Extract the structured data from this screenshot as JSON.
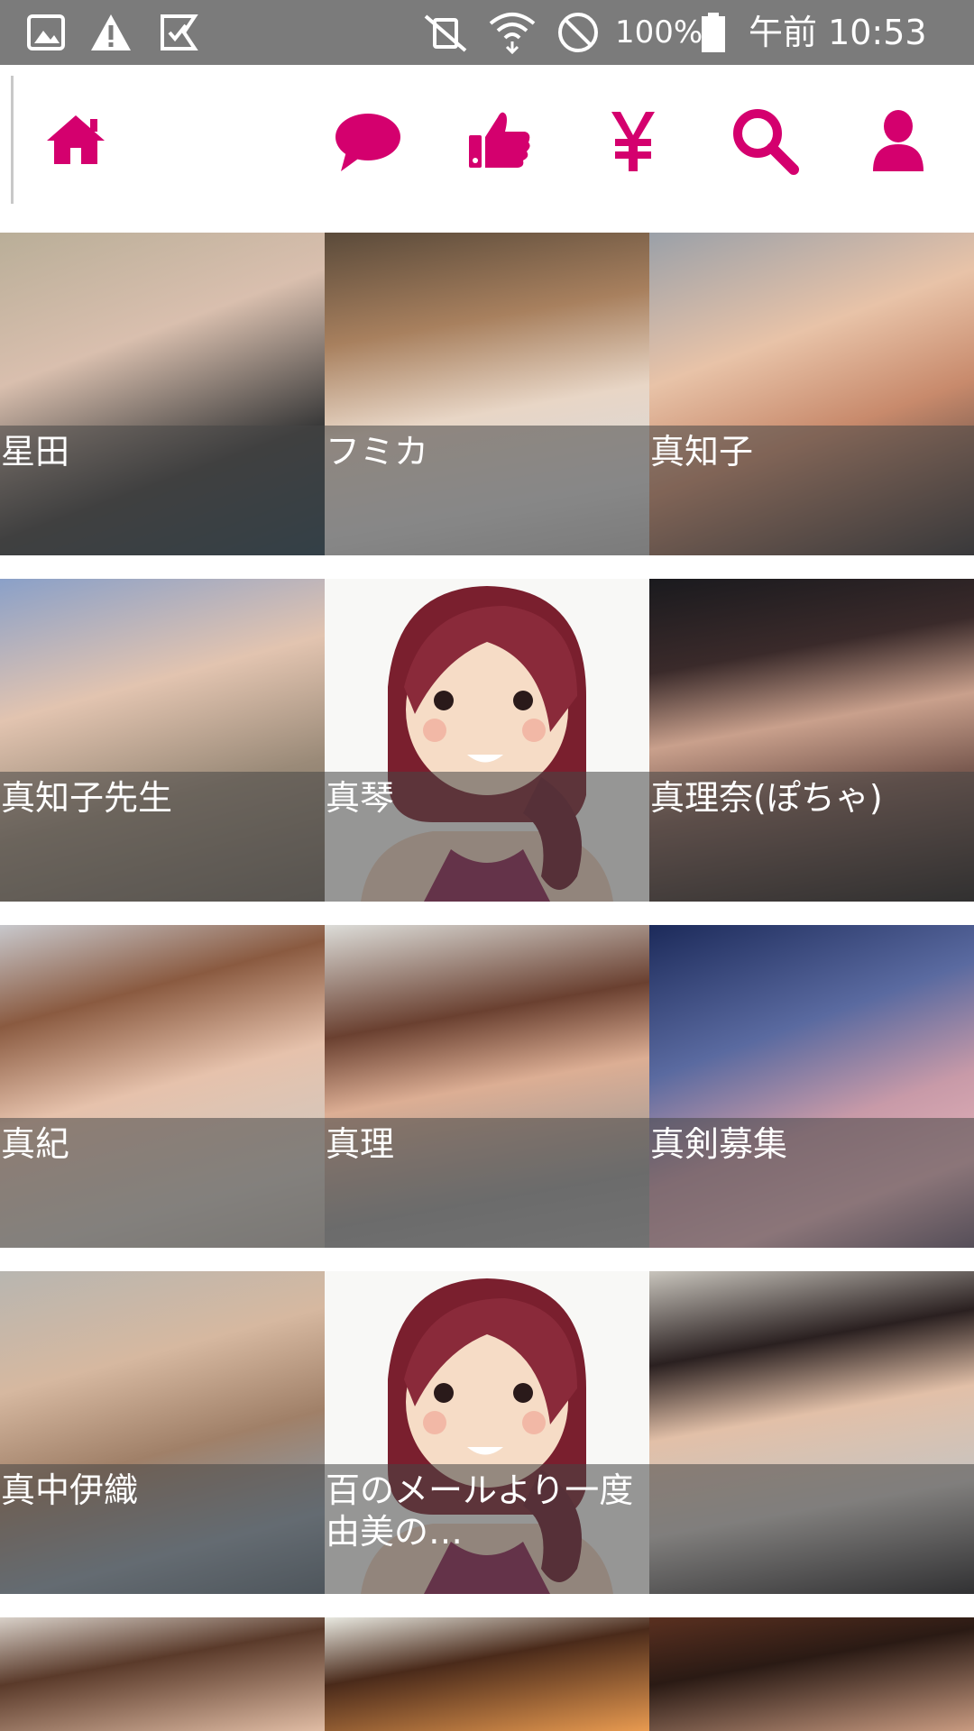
{
  "status_bar": {
    "battery": "100%",
    "time": "午前 10:53",
    "icons": [
      "image-icon",
      "warning-icon",
      "checkmark-icon",
      "vibrate-mute-icon",
      "wifi-icon",
      "block-icon",
      "battery-icon"
    ]
  },
  "nav": {
    "items": [
      {
        "name": "home-icon",
        "label": ""
      },
      {
        "name": "chat-icon",
        "label": ""
      },
      {
        "name": "thumbs-up-icon",
        "label": ""
      },
      {
        "name": "yen-icon",
        "label": "¥"
      },
      {
        "name": "search-icon",
        "label": ""
      },
      {
        "name": "profile-icon",
        "label": ""
      }
    ],
    "accent": "#d4006e"
  },
  "profiles": [
    {
      "name": "星田",
      "photo": true
    },
    {
      "name": "フミカ",
      "photo": true
    },
    {
      "name": "真知子",
      "photo": true
    },
    {
      "name": "真知子先生",
      "photo": true
    },
    {
      "name": "真琴",
      "photo": false
    },
    {
      "name": "真理奈(ぽちゃ)",
      "photo": true
    },
    {
      "name": "真紀",
      "photo": true
    },
    {
      "name": "真理",
      "photo": true
    },
    {
      "name": "真剣募集",
      "photo": true
    },
    {
      "name": "真中伊織",
      "photo": true
    },
    {
      "name": "百のメールより一度由美の…",
      "photo": false
    },
    {
      "name": "",
      "photo": true
    },
    {
      "name": "",
      "photo": true
    },
    {
      "name": "",
      "photo": true
    },
    {
      "name": "",
      "photo": true
    }
  ]
}
